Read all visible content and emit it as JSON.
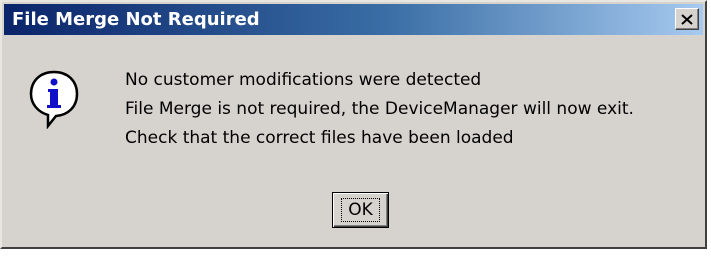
{
  "window": {
    "title": "File Merge Not Required",
    "close_icon": "close-icon"
  },
  "dialog": {
    "icon": "info-icon",
    "icon_letter": "i",
    "messages": [
      "No customer modifications were detected",
      "File Merge is not required, the DeviceManager will now exit.",
      "Check that the correct files have been loaded"
    ],
    "ok_label": "OK"
  },
  "colors": {
    "titlebar_start": "#0a246a",
    "titlebar_end": "#a6caf0",
    "dialog_bg": "#d6d3ce",
    "icon_fill": "#1010c8"
  }
}
